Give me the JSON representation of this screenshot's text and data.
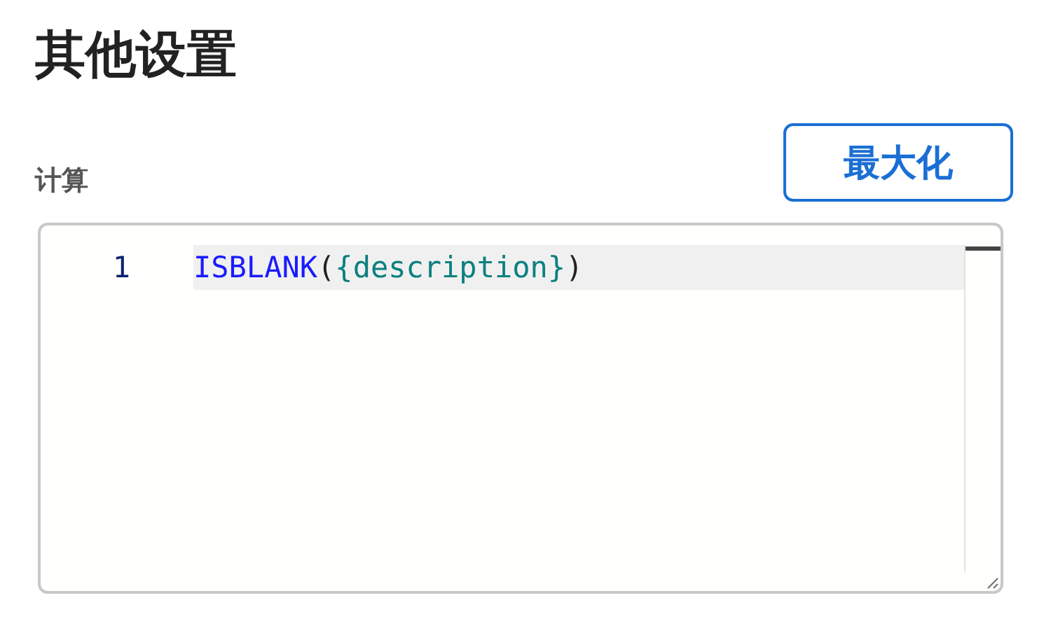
{
  "title": "其他设置",
  "field_label": "计算",
  "maximize_button": "最大化",
  "editor": {
    "lines": [
      {
        "number": "1",
        "current": true,
        "tokens": [
          {
            "kind": "function",
            "text": "ISBLANK"
          },
          {
            "kind": "punct",
            "text": "("
          },
          {
            "kind": "field",
            "text": "{description}"
          },
          {
            "kind": "punct",
            "text": ")"
          }
        ]
      }
    ]
  }
}
